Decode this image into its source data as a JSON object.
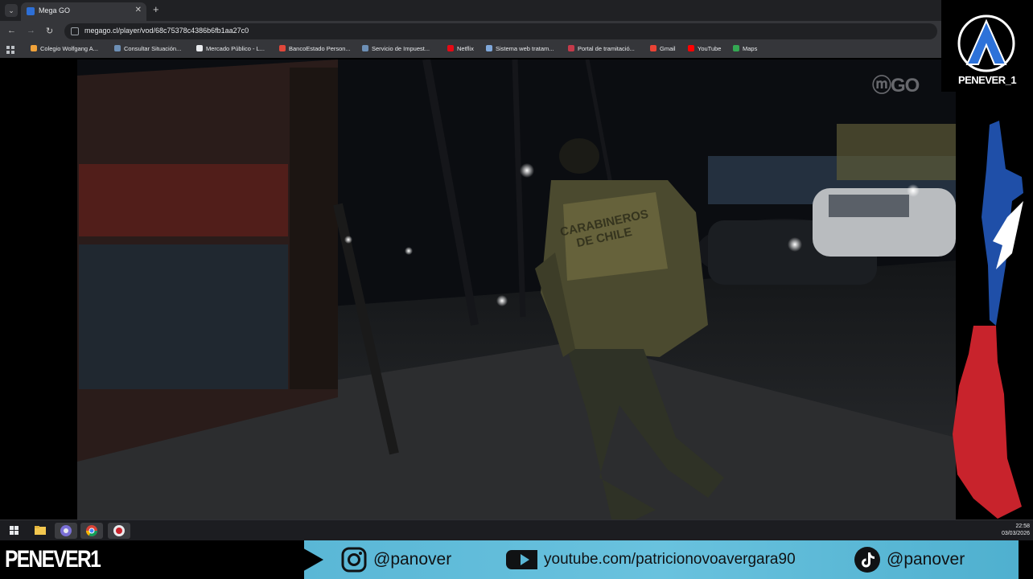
{
  "browser": {
    "tab": {
      "title": "Mega GO"
    },
    "new_tab_label": "+",
    "tab_menu_label": "⌄",
    "close_label": "✕",
    "nav": {
      "back": "←",
      "forward": "→",
      "reload": "↻"
    },
    "url": "megago.cl/player/vod/68c75378c4386b6fb1aa27c0",
    "bookmarks": [
      {
        "label": "Colegio Wolfgang A...",
        "color": "#f0a23a"
      },
      {
        "label": "Consultar Situación...",
        "color": "#6d8fb5"
      },
      {
        "label": "Mercado Público - L...",
        "color": "#e8eaed"
      },
      {
        "label": "BancoEstado Person...",
        "color": "#e0473a"
      },
      {
        "label": "Servicio de Impuest...",
        "color": "#6d8fb5"
      },
      {
        "label": "Netflix",
        "color": "#e50914"
      },
      {
        "label": "Sistema web tratam...",
        "color": "#7fa7d9"
      },
      {
        "label": "Portal de tramitació...",
        "color": "#c43a4a"
      },
      {
        "label": "Gmail",
        "color": "#ea4335"
      },
      {
        "label": "YouTube",
        "color": "#ff0000"
      },
      {
        "label": "Maps",
        "color": "#34a853"
      }
    ]
  },
  "video": {
    "watermark": "GO",
    "vest_text_line1": "CARABINEROS",
    "vest_text_line2": "DE CHILE"
  },
  "brand": {
    "name": "PENEVER_1"
  },
  "taskbar": {
    "items": [
      "windows-start",
      "file-explorer",
      "chrome-profile",
      "chrome",
      "recorder"
    ],
    "time": "22:58",
    "date": "03/03/2026"
  },
  "footer": {
    "name": "PENEVER1",
    "instagram": "@panover",
    "youtube": "youtube.com/patricionovoavergara90",
    "tiktok": "@panover"
  },
  "colors": {
    "band": "#5ab7d6",
    "flag_blue": "#1f4fa8",
    "flag_red": "#c8232c",
    "flag_white": "#ffffff"
  }
}
